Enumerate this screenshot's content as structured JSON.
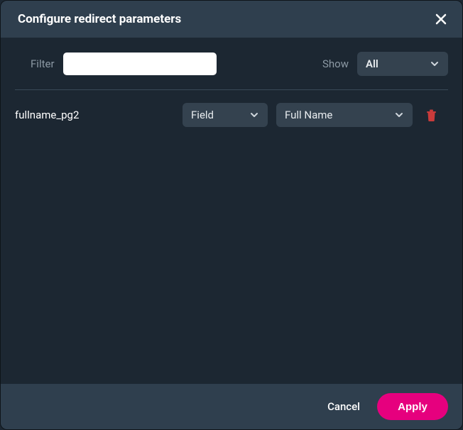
{
  "header": {
    "title": "Configure redirect parameters"
  },
  "filter": {
    "label": "Filter",
    "value": ""
  },
  "show": {
    "label": "Show",
    "selected": "All"
  },
  "params": [
    {
      "name": "fullname_pg2",
      "type": "Field",
      "value": "Full Name"
    }
  ],
  "footer": {
    "cancel": "Cancel",
    "apply": "Apply"
  },
  "colors": {
    "accent": "#e6007e",
    "panel": "#2f3f4e",
    "body": "#1c2732",
    "trash": "#c93b3b"
  }
}
